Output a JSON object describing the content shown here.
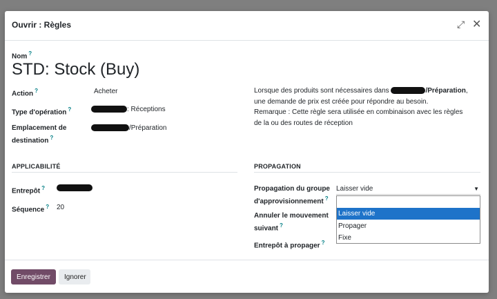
{
  "modal": {
    "title": "Ouvrir : Règles",
    "expand_icon": "expand-icon",
    "close_icon": "close-icon"
  },
  "form": {
    "name_label": "Nom",
    "name_value": "STD: Stock (Buy)",
    "action_label": "Action",
    "action_value": "Acheter",
    "operation_type_label": "Type d'opération",
    "operation_type_value": ": Réceptions",
    "destination_label_1": "Emplacement de",
    "destination_label_2": "destination",
    "destination_value": "/Préparation",
    "help_mark": "?"
  },
  "description": {
    "line1_pre": "Lorsque des produits sont nécessaires dans ",
    "line1_bold": "/Préparation",
    "line1_post": ",",
    "line2": "une demande de prix est créée pour répondre au besoin.",
    "line3": "Remarque : Cette règle sera utilisée en combinaison avec les règles",
    "line4": "de la ou des routes de réception"
  },
  "applicability": {
    "title": "APPLICABILITÉ",
    "warehouse_label": "Entrepôt",
    "sequence_label": "Séquence",
    "sequence_value": "20"
  },
  "propagation": {
    "title": "PROPAGATION",
    "group_label_1": "Propagation du groupe",
    "group_label_2": "d'approvisionnement",
    "group_value": "Laisser vide",
    "cancel_label_1": "Annuler le mouvement",
    "cancel_label_2": "suivant",
    "warehouse_label": "Entrepôt à propager",
    "options": [
      "Laisser vide",
      "Propager",
      "Fixe"
    ]
  },
  "footer": {
    "save": "Enregistrer",
    "discard": "Ignorer"
  }
}
